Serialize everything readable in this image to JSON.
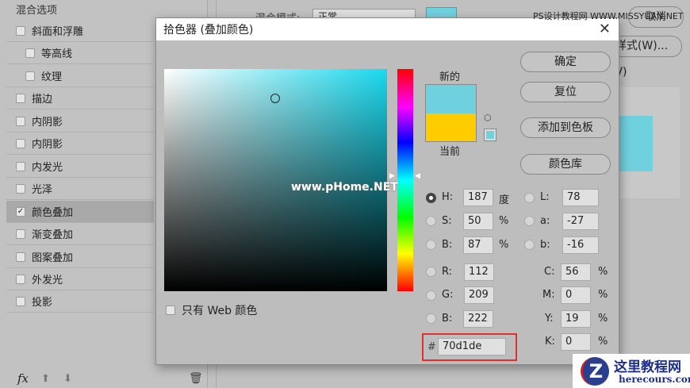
{
  "left_panel": {
    "title": "混合选项",
    "items": [
      {
        "label": "斜面和浮雕",
        "checked": false
      },
      {
        "label": "等高线",
        "checked": false
      },
      {
        "label": "纹理",
        "checked": false
      },
      {
        "label": "描边",
        "checked": false
      },
      {
        "label": "内阴影",
        "checked": false
      },
      {
        "label": "内阴影",
        "checked": false
      },
      {
        "label": "内发光",
        "checked": false
      },
      {
        "label": "光泽",
        "checked": false
      },
      {
        "label": "颜色叠加",
        "checked": true
      },
      {
        "label": "渐变叠加",
        "checked": false
      },
      {
        "label": "图案叠加",
        "checked": false
      },
      {
        "label": "外发光",
        "checked": false
      },
      {
        "label": "投影",
        "checked": false
      }
    ],
    "fx": "fx"
  },
  "background": {
    "blend_mode_label": "混合模式:",
    "blend_mode_value": "正常",
    "cancel": "取消",
    "new_style": "新建样式(W)...",
    "preview": "预览(V)",
    "overlay_color": "#70d1de"
  },
  "dialog": {
    "title": "拾色器 (叠加颜色)",
    "close": "✕",
    "new_label": "新的",
    "current_label": "当前",
    "new_color": "#70d1de",
    "current_color": "#ffcc00",
    "buttons": {
      "ok": "确定",
      "reset": "复位",
      "add_swatch": "添加到色板",
      "libraries": "颜色库"
    },
    "web_only": "只有 Web 颜色",
    "hsb": {
      "h": "187",
      "s": "50",
      "b": "87",
      "h_unit": "度",
      "pct": "%"
    },
    "lab": {
      "l": "78",
      "a": "-27",
      "b": "-16"
    },
    "rgb": {
      "r": "112",
      "g": "209",
      "b": "222"
    },
    "cmyk": {
      "c": "56",
      "m": "0",
      "y": "19",
      "k": "0"
    },
    "labels": {
      "H": "H:",
      "S": "S:",
      "B": "B:",
      "L": "L:",
      "a": "a:",
      "b": "b:",
      "R": "R:",
      "G": "G:",
      "B2": "B:",
      "C": "C:",
      "M": "M:",
      "Y": "Y:",
      "K": "K:",
      "hash": "#"
    },
    "hex": "70d1de"
  },
  "watermarks": {
    "top": "PS设计教程网 WWW.MISSYUAN.NET",
    "center": "www.pHome.NET",
    "logo_cn": "这里教程网",
    "logo_url": "herecours.com"
  }
}
